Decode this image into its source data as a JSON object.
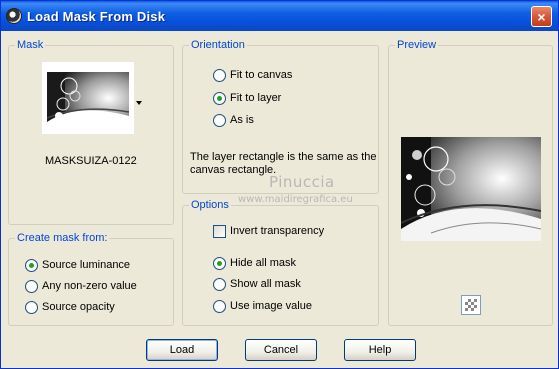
{
  "window": {
    "title": "Load Mask From Disk",
    "close_symbol": "×"
  },
  "mask": {
    "label": "Mask",
    "name": "MASKSUIZA-0122"
  },
  "orientation": {
    "label": "Orientation",
    "options": [
      "Fit to canvas",
      "Fit to layer",
      "As is"
    ],
    "selected": 1,
    "description": "The layer rectangle is the same as the canvas rectangle."
  },
  "watermark": {
    "name": "Pinuccia",
    "url": "www.maidiregrafica.eu"
  },
  "preview": {
    "label": "Preview"
  },
  "create_mask": {
    "label": "Create mask from:",
    "options": [
      "Source luminance",
      "Any non-zero value",
      "Source opacity"
    ],
    "selected": 0
  },
  "options": {
    "label": "Options",
    "invert_label": "Invert transparency",
    "invert_checked": false,
    "hide_options": [
      "Hide all mask",
      "Show all mask",
      "Use image value"
    ],
    "selected": 0
  },
  "buttons": {
    "load": "Load",
    "cancel": "Cancel",
    "help": "Help"
  },
  "colors": {
    "title_bar": "#0a5ddc",
    "group_label": "#0046d5",
    "dialog_bg": "#ece9d8"
  }
}
